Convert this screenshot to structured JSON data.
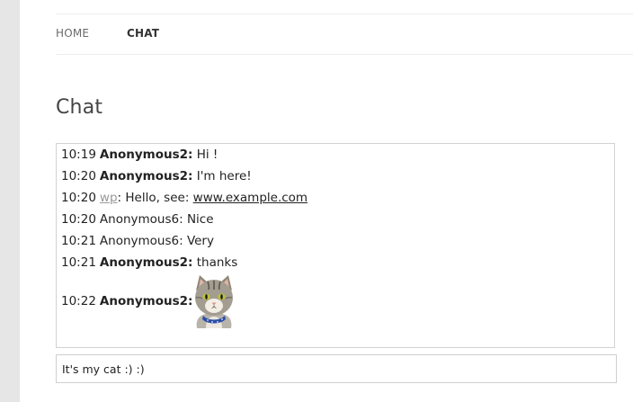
{
  "nav": {
    "items": [
      "HOME",
      "CHAT"
    ]
  },
  "page": {
    "title": "Chat"
  },
  "messages": [
    {
      "time": "10:19",
      "user": "Anonymous2:",
      "text": "Hi !"
    },
    {
      "time": "10:20",
      "user": "Anonymous2:",
      "text": "I'm here!"
    },
    {
      "time": "10:20",
      "user": "wp",
      "text": ": Hello, see: ",
      "link": "www.example.com"
    },
    {
      "time": "10:20",
      "user": "Anonymous6:",
      "text": "Nice"
    },
    {
      "time": "10:21",
      "user": "Anonymous6:",
      "text": "Very"
    },
    {
      "time": "10:21",
      "user": "Anonymous2:",
      "text": "thanks"
    },
    {
      "time": "10:22",
      "user": "Anonymous2:",
      "image": "cat-photo"
    }
  ],
  "input": {
    "value": "It's my cat :) :)"
  }
}
